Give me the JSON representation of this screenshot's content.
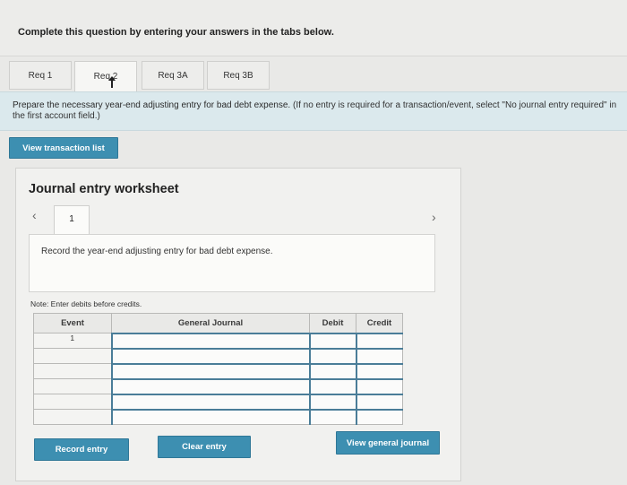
{
  "instruction": "Complete this question by entering your answers in the tabs below.",
  "tabs": [
    {
      "label": "Req 1"
    },
    {
      "label": "Req 2"
    },
    {
      "label": "Req 3A"
    },
    {
      "label": "Req 3B"
    }
  ],
  "prompt": {
    "main": "Prepare the necessary year-end adjusting entry for bad debt expense.",
    "hint": "(If no entry is required for a transaction/event, select \"No journal entry required\" in the first account field.)"
  },
  "view_transaction_label": "View transaction list",
  "worksheet": {
    "title": "Journal entry worksheet",
    "entry_number": "1",
    "record_text": "Record the year-end adjusting entry for bad debt expense.",
    "note": "Note: Enter debits before credits.",
    "columns": {
      "event": "Event",
      "general_journal": "General Journal",
      "debit": "Debit",
      "credit": "Credit"
    },
    "first_event": "1",
    "record_entry_label": "Record entry",
    "clear_entry_label": "Clear entry",
    "view_general_journal_label": "View general journal"
  }
}
